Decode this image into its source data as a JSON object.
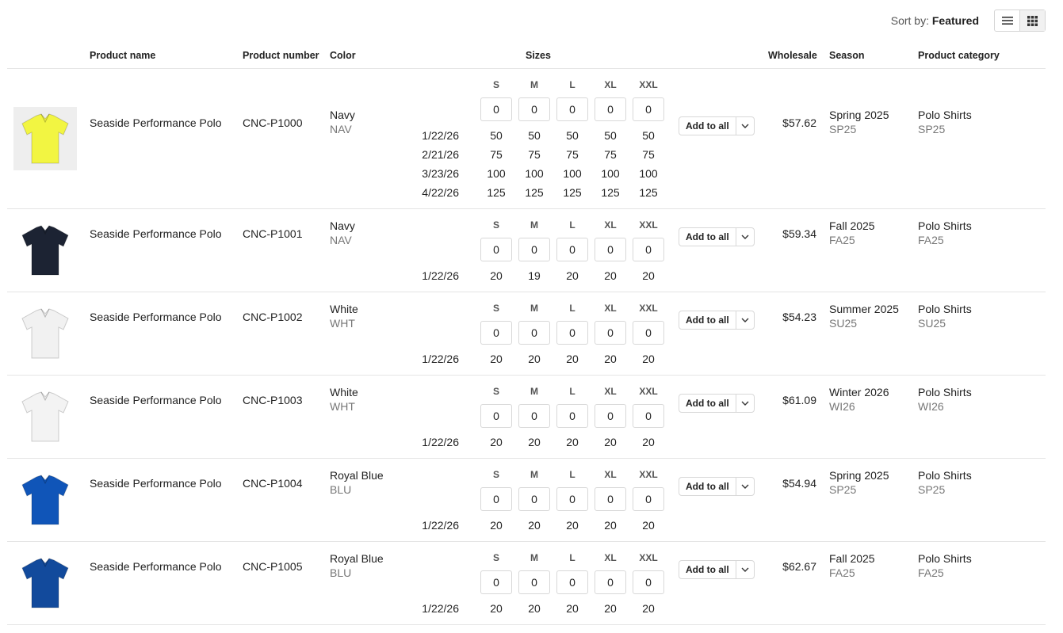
{
  "toolbar": {
    "sort_prefix": "Sort by:",
    "sort_value": "Featured",
    "list_view_icon": "list-icon",
    "grid_view_icon": "grid-icon"
  },
  "columns": {
    "product_name": "Product name",
    "product_number": "Product number",
    "color": "Color",
    "sizes": "Sizes",
    "wholesale": "Wholesale",
    "season": "Season",
    "product_category": "Product category"
  },
  "size_labels": [
    "S",
    "M",
    "L",
    "XL",
    "XXL"
  ],
  "add_to_all_label": "Add to all",
  "rows": [
    {
      "image_icon": "yellow-polo-shirt-icon",
      "name": "Seaside Performance Polo",
      "number": "CNC-P1000",
      "color": "Navy",
      "color_code": "NAV",
      "qty": [
        "0",
        "0",
        "0",
        "0",
        "0"
      ],
      "availability": [
        {
          "date": "1/22/26",
          "values": [
            "50",
            "50",
            "50",
            "50",
            "50"
          ]
        },
        {
          "date": "2/21/26",
          "values": [
            "75",
            "75",
            "75",
            "75",
            "75"
          ]
        },
        {
          "date": "3/23/26",
          "values": [
            "100",
            "100",
            "100",
            "100",
            "100"
          ]
        },
        {
          "date": "4/22/26",
          "values": [
            "125",
            "125",
            "125",
            "125",
            "125"
          ]
        }
      ],
      "price": "$57.62",
      "season": "Spring 2025",
      "season_code": "SP25",
      "category": "Polo Shirts",
      "category_code": "SP25",
      "shirt_color": "#f2f542"
    },
    {
      "image_icon": "navy-polo-shirt-icon",
      "name": "Seaside Performance Polo",
      "number": "CNC-P1001",
      "color": "Navy",
      "color_code": "NAV",
      "qty": [
        "0",
        "0",
        "0",
        "0",
        "0"
      ],
      "availability": [
        {
          "date": "1/22/26",
          "values": [
            "20",
            "19",
            "20",
            "20",
            "20"
          ]
        }
      ],
      "price": "$59.34",
      "season": "Fall 2025",
      "season_code": "FA25",
      "category": "Polo Shirts",
      "category_code": "FA25",
      "shirt_color": "#1c2333"
    },
    {
      "image_icon": "white-polo-shirt-icon",
      "name": "Seaside Performance Polo",
      "number": "CNC-P1002",
      "color": "White",
      "color_code": "WHT",
      "qty": [
        "0",
        "0",
        "0",
        "0",
        "0"
      ],
      "availability": [
        {
          "date": "1/22/26",
          "values": [
            "20",
            "20",
            "20",
            "20",
            "20"
          ]
        }
      ],
      "price": "$54.23",
      "season": "Summer 2025",
      "season_code": "SU25",
      "category": "Polo Shirts",
      "category_code": "SU25",
      "shirt_color": "#f1f1f1"
    },
    {
      "image_icon": "white-polo-shirt-icon",
      "name": "Seaside Performance Polo",
      "number": "CNC-P1003",
      "color": "White",
      "color_code": "WHT",
      "qty": [
        "0",
        "0",
        "0",
        "0",
        "0"
      ],
      "availability": [
        {
          "date": "1/22/26",
          "values": [
            "20",
            "20",
            "20",
            "20",
            "20"
          ]
        }
      ],
      "price": "$61.09",
      "season": "Winter 2026",
      "season_code": "WI26",
      "category": "Polo Shirts",
      "category_code": "WI26",
      "shirt_color": "#f3f3f3"
    },
    {
      "image_icon": "royal-blue-polo-shirt-icon",
      "name": "Seaside Performance Polo",
      "number": "CNC-P1004",
      "color": "Royal Blue",
      "color_code": "BLU",
      "qty": [
        "0",
        "0",
        "0",
        "0",
        "0"
      ],
      "availability": [
        {
          "date": "1/22/26",
          "values": [
            "20",
            "20",
            "20",
            "20",
            "20"
          ]
        }
      ],
      "price": "$54.94",
      "season": "Spring 2025",
      "season_code": "SP25",
      "category": "Polo Shirts",
      "category_code": "SP25",
      "shirt_color": "#1055b8"
    },
    {
      "image_icon": "royal-blue-polo-shirt-icon",
      "name": "Seaside Performance Polo",
      "number": "CNC-P1005",
      "color": "Royal Blue",
      "color_code": "BLU",
      "qty": [
        "0",
        "0",
        "0",
        "0",
        "0"
      ],
      "availability": [
        {
          "date": "1/22/26",
          "values": [
            "20",
            "20",
            "20",
            "20",
            "20"
          ]
        }
      ],
      "price": "$62.67",
      "season": "Fall 2025",
      "season_code": "FA25",
      "category": "Polo Shirts",
      "category_code": "FA25",
      "shirt_color": "#124a9c"
    }
  ]
}
